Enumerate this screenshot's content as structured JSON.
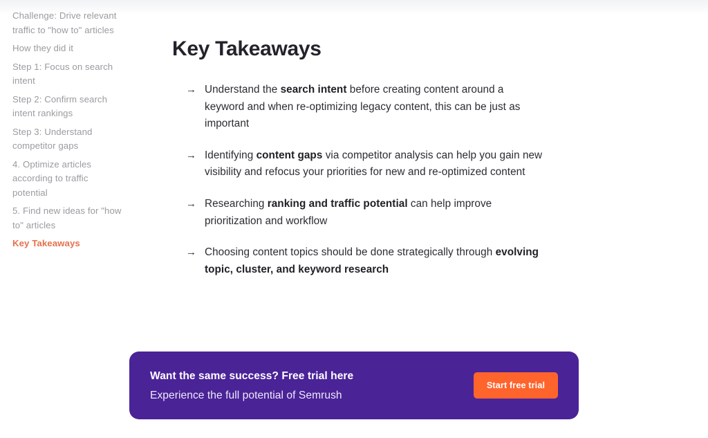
{
  "sidebar": {
    "name": "article-table-of-contents",
    "items": [
      {
        "label": "Challenge: Drive relevant traffic to \"how to\" articles",
        "active": false
      },
      {
        "label": "How they did it",
        "active": false
      },
      {
        "label": "Step 1: Focus on search intent",
        "active": false
      },
      {
        "label": "Step 2: Confirm search intent rankings",
        "active": false
      },
      {
        "label": "Step 3: Understand competitor gaps",
        "active": false
      },
      {
        "label": "4. Optimize articles according to traffic potential",
        "active": false
      },
      {
        "label": "5. Find new ideas for \"how to\" articles",
        "active": false
      },
      {
        "label": "Key Takeaways",
        "active": true
      }
    ]
  },
  "main": {
    "title": "Key Takeaways",
    "bullet_icon": "arrow-right-icon",
    "bullet_glyph": "→",
    "takeaways": [
      {
        "parts": [
          {
            "text": "Understand the ",
            "bold": false
          },
          {
            "text": "search intent",
            "bold": true
          },
          {
            "text": " before creating content around a keyword and when re-optimizing legacy content, this can be just as important",
            "bold": false
          }
        ]
      },
      {
        "parts": [
          {
            "text": "Identifying ",
            "bold": false
          },
          {
            "text": "content gaps",
            "bold": true
          },
          {
            "text": " via competitor analysis can help you gain new visibility and refocus your priorities for new and re-optimized content",
            "bold": false
          }
        ]
      },
      {
        "parts": [
          {
            "text": "Researching ",
            "bold": false
          },
          {
            "text": "ranking and traffic potential",
            "bold": true
          },
          {
            "text": " can help improve prioritization and workflow",
            "bold": false
          }
        ]
      },
      {
        "parts": [
          {
            "text": "Choosing content topics should be done strategically through ",
            "bold": false
          },
          {
            "text": "evolving topic, cluster, and  keyword research",
            "bold": true
          }
        ]
      }
    ]
  },
  "cta": {
    "title": "Want the same success? Free trial here",
    "subtitle": "Experience the full potential of Semrush",
    "button_label": "Start free trial"
  },
  "colors": {
    "page_background": "#ffffff",
    "sidebar_text": "#9b9ba1",
    "sidebar_active_text": "#e5714b",
    "heading_text": "#23232b",
    "body_text": "#2b2b33",
    "cta_background": "#4a2397",
    "cta_button_background": "#ff642d",
    "cta_button_text": "#ffffff"
  }
}
